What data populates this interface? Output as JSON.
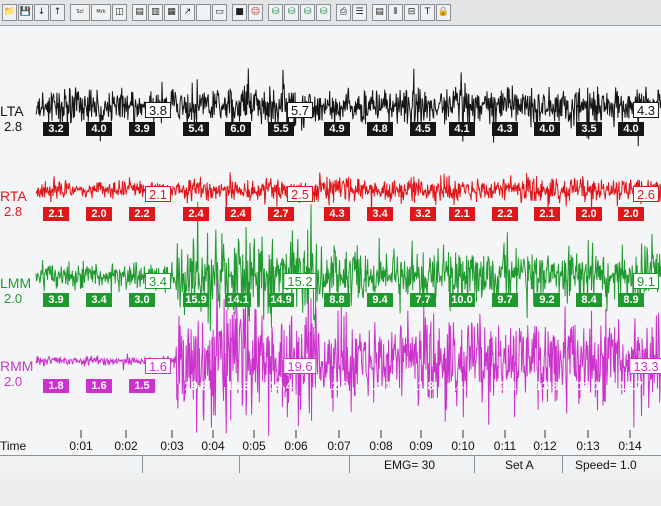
{
  "colors": {
    "LTA": "#151515",
    "RTA": "#e0161a",
    "LMM": "#1f9a2e",
    "RMM": "#cc33cc",
    "background": "#f4f5f6"
  },
  "toolbar": {
    "buttons": [
      {
        "name": "open-folder-icon",
        "glyph": "📁"
      },
      {
        "name": "save-icon",
        "glyph": "💾"
      },
      {
        "name": "arrow-down-icon",
        "glyph": "↓"
      },
      {
        "name": "arrow-up-icon",
        "glyph": "↑"
      },
      {
        "name": "scale-icon",
        "glyph": "Scl"
      },
      {
        "name": "mark-icon",
        "glyph": "Mrk"
      },
      {
        "name": "split-view-icon",
        "glyph": "◫"
      },
      {
        "name": "grid-icon",
        "glyph": "▤"
      },
      {
        "name": "bar-chart-icon",
        "glyph": "▥"
      },
      {
        "name": "graph-icon",
        "glyph": "▦"
      },
      {
        "name": "cursor-icon",
        "glyph": "↗"
      },
      {
        "name": "blank-icon",
        "glyph": ""
      },
      {
        "name": "page-icon",
        "glyph": "▭"
      },
      {
        "name": "stop-icon",
        "glyph": "■"
      },
      {
        "name": "person-icon",
        "glyph": "☺"
      },
      {
        "name": "record-1-icon",
        "glyph": "⛁"
      },
      {
        "name": "record-2-icon",
        "glyph": "⛁"
      },
      {
        "name": "record-3-icon",
        "glyph": "⛁"
      },
      {
        "name": "record-4-icon",
        "glyph": "⛁"
      },
      {
        "name": "printer-icon",
        "glyph": "⎙"
      },
      {
        "name": "list-icon",
        "glyph": "☰"
      },
      {
        "name": "table-icon",
        "glyph": "▤"
      },
      {
        "name": "columns-icon",
        "glyph": "⫴"
      },
      {
        "name": "split-icon",
        "glyph": "⊟"
      },
      {
        "name": "text-icon",
        "glyph": "T"
      },
      {
        "name": "lock-icon",
        "glyph": "🔒"
      }
    ]
  },
  "channels": [
    {
      "key": "LTA",
      "label": "LTA",
      "gain": "2.8",
      "segments": [
        {
          "peak": "3.8",
          "values": [
            "3.2",
            "4.0",
            "3.9"
          ]
        },
        {
          "peak": "5.7",
          "values": [
            "5.4",
            "6.0",
            "5.5"
          ]
        },
        {
          "peak": "4.3",
          "values": [
            "4.9",
            "4.8",
            "4.5",
            "4.1",
            "4.3",
            "4.0",
            "3.5",
            "4.0"
          ]
        }
      ]
    },
    {
      "key": "RTA",
      "label": "RTA",
      "gain": "2.8",
      "segments": [
        {
          "peak": "2.1",
          "values": [
            "2.1",
            "2.0",
            "2.2"
          ]
        },
        {
          "peak": "2.5",
          "values": [
            "2.4",
            "2.4",
            "2.7"
          ]
        },
        {
          "peak": "2.6",
          "values": [
            "4.3",
            "3.4",
            "3.2",
            "2.1",
            "2.2",
            "2.1",
            "2.0",
            "2.0"
          ]
        }
      ]
    },
    {
      "key": "LMM",
      "label": "LMM",
      "gain": "2.0",
      "segments": [
        {
          "peak": "3.4",
          "values": [
            "3.9",
            "3.4",
            "3.0"
          ]
        },
        {
          "peak": "15.2",
          "values": [
            "15.9",
            "14.1",
            "14.9"
          ]
        },
        {
          "peak": "9.1",
          "values": [
            "8.8",
            "9.4",
            "7.7",
            "10.0",
            "9.7",
            "9.2",
            "8.4",
            "8.9"
          ]
        }
      ]
    },
    {
      "key": "RMM",
      "label": "RMM",
      "gain": "2.0",
      "segments": [
        {
          "peak": "1.6",
          "values": [
            "1.8",
            "1.6",
            "1.5"
          ]
        },
        {
          "peak": "19.6",
          "values": [
            "19.8",
            "19.3",
            "19.4"
          ]
        },
        {
          "peak": "13.3",
          "values": [
            "12.9",
            "14.1",
            "11.8",
            "14.2",
            "13.1",
            "13.8",
            "13.1",
            "12.7"
          ]
        }
      ]
    }
  ],
  "time_axis": {
    "title": "Time",
    "ticks": [
      "0:01",
      "0:02",
      "0:03",
      "0:04",
      "0:05",
      "0:06",
      "0:07",
      "0:08",
      "0:09",
      "0:10",
      "0:11",
      "0:12",
      "0:13",
      "0:14"
    ]
  },
  "status": {
    "emg": "EMG= 30",
    "set": "Set A",
    "speed": "Speed= 1.0"
  }
}
